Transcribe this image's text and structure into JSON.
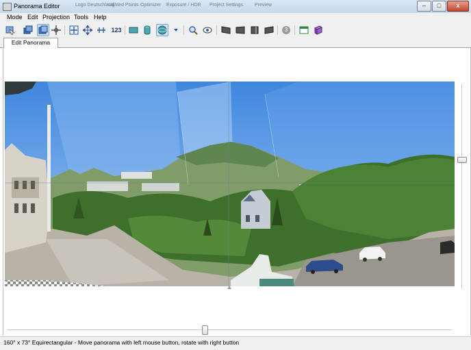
{
  "window": {
    "title": "Panorama Editor",
    "background_tabs": [
      "Logo Deutschland",
      "Lighted Points",
      "Optimizer",
      "Exposure / HDR",
      "Project Settings",
      "Preview"
    ],
    "minimize_glyph": "–",
    "maximize_glyph": "□",
    "close_glyph": "x"
  },
  "menu": [
    "Mode",
    "Edit",
    "Projection",
    "Tools",
    "Help"
  ],
  "toolbar": {
    "icons": [
      "normal-mode-icon",
      "layers-icon",
      "move-mode-icon",
      "crop-icon",
      "center-icon",
      "move-panorama-icon",
      "straighten-icon",
      "numeric-transform-icon",
      "rectilinear-icon",
      "cylindrical-icon",
      "equirectangular-icon",
      "projection-dropdown-icon",
      "zoom-icon",
      "preview-icon",
      "blend-icon-1",
      "blend-icon-2",
      "blend-icon-3",
      "blend-icon-4",
      "overlap-count-icon",
      "show-all-icon",
      "fit-icon"
    ],
    "numeric_label": "123",
    "overlap_count": "3",
    "accent_active": "#cfe2f8"
  },
  "tabs": [
    {
      "label": "Edit Panorama",
      "active": true
    }
  ],
  "status_text": "160° x 73° Equirectangular - Move panorama with left mouse button, rotate with right button",
  "sliders": {
    "horizontal_position": 0.45,
    "vertical_position": 0.37
  },
  "colors": {
    "sky": "#4f95e6",
    "sky_light": "#9fc8f5",
    "mountain": "#7f9c69",
    "foliage": "#3f6f2c",
    "plaza": "#b9b2a6"
  }
}
